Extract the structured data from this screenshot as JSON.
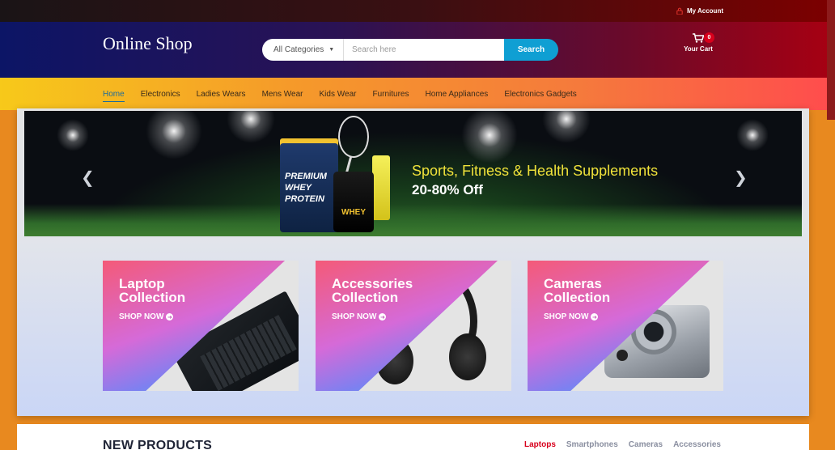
{
  "topbar": {
    "account_label": "My Account"
  },
  "header": {
    "logo": "Online Shop",
    "search": {
      "category": "All Categories",
      "placeholder": "Search here",
      "button": "Search"
    },
    "cart": {
      "count": "0",
      "label": "Your Cart"
    }
  },
  "nav": {
    "items": [
      {
        "label": "Home",
        "active": true
      },
      {
        "label": "Electronics"
      },
      {
        "label": "Ladies Wears"
      },
      {
        "label": "Mens Wear"
      },
      {
        "label": "Kids Wear"
      },
      {
        "label": "Furnitures"
      },
      {
        "label": "Home Appliances"
      },
      {
        "label": "Electronics Gadgets"
      }
    ]
  },
  "hero": {
    "title": "Sports, Fitness & Health Supplements",
    "subtitle": "20-80% Off",
    "product_tub": "PREMIUM WHEY PROTEIN",
    "product_jar": "WHEY",
    "prev": "❮",
    "next": "❯"
  },
  "collections": [
    {
      "line1": "Laptop",
      "line2": "Collection",
      "cta": "SHOP NOW"
    },
    {
      "line1": "Accessories",
      "line2": "Collection",
      "cta": "SHOP NOW"
    },
    {
      "line1": "Cameras",
      "line2": "Collection",
      "cta": "SHOP NOW"
    }
  ],
  "new_products": {
    "title": "NEW PRODUCTS",
    "tabs": [
      {
        "label": "Laptops",
        "active": true
      },
      {
        "label": "Smartphones"
      },
      {
        "label": "Cameras"
      },
      {
        "label": "Accessories"
      }
    ]
  },
  "colors": {
    "accent": "#0f9fd3",
    "badge": "#d8001c",
    "nav_active": "#1d6b9a"
  },
  "icons": {
    "account": "lock-icon",
    "cart": "cart-icon",
    "cta": "arrow-circle-right-icon"
  }
}
